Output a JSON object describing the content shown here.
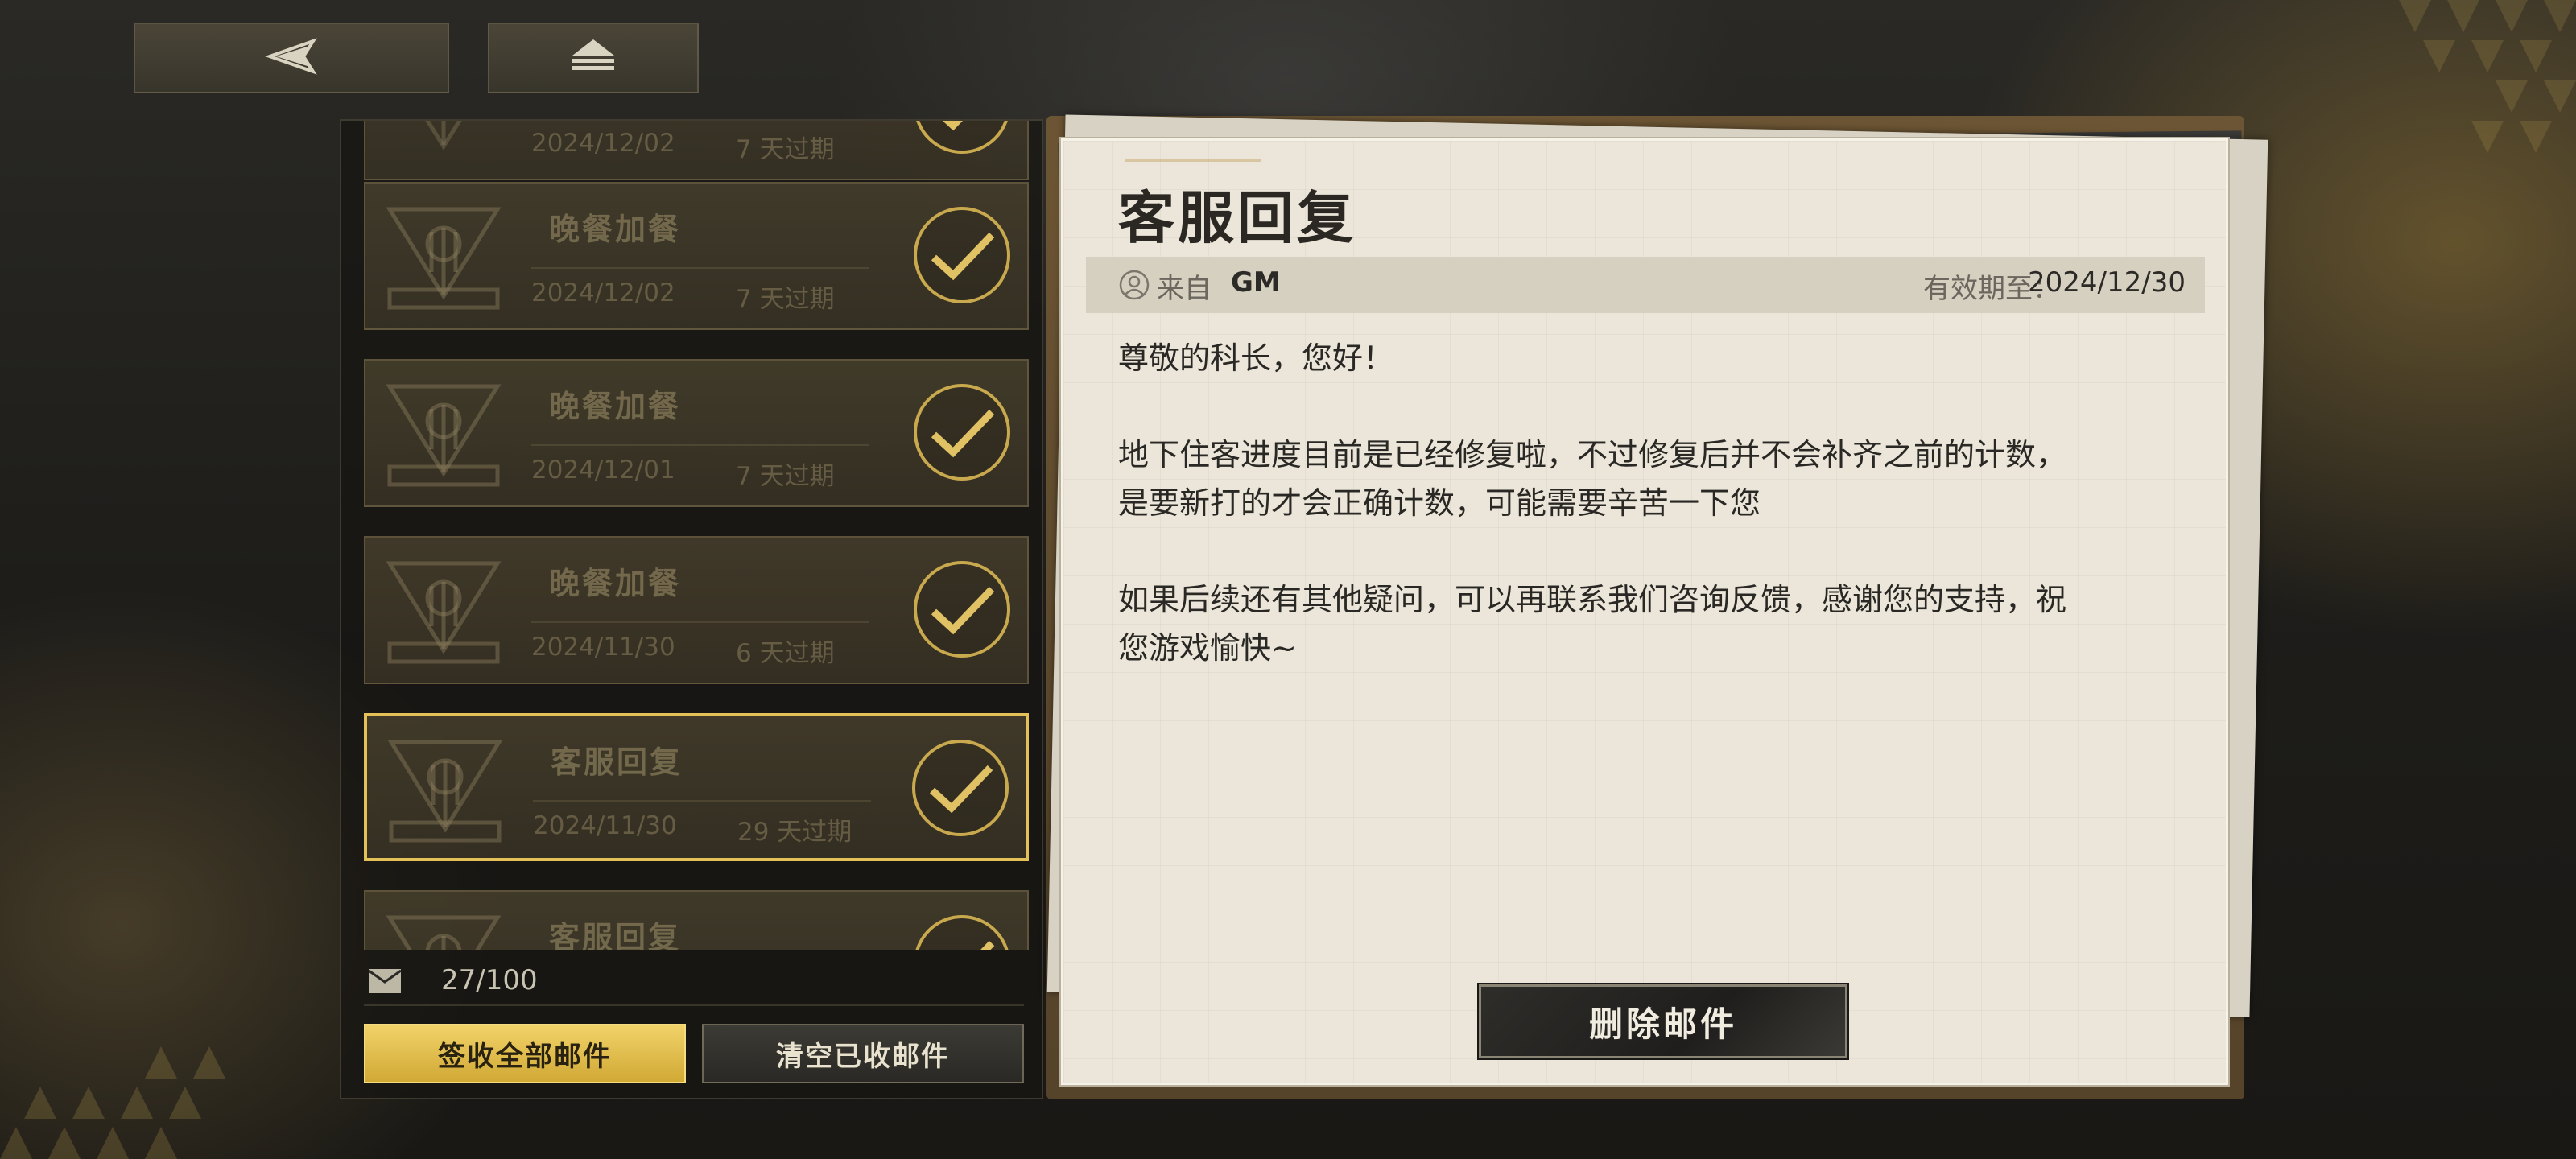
{
  "nav": {
    "back_icon": "back-arrow-icon",
    "home_icon": "home-icon"
  },
  "mail_list": {
    "items": [
      {
        "title": "",
        "date": "2024/12/02",
        "expiry": "7 天过期",
        "claimed": true,
        "selected": false
      },
      {
        "title": "晚餐加餐",
        "date": "2024/12/02",
        "expiry": "7 天过期",
        "claimed": true,
        "selected": false
      },
      {
        "title": "晚餐加餐",
        "date": "2024/12/01",
        "expiry": "7 天过期",
        "claimed": true,
        "selected": false
      },
      {
        "title": "晚餐加餐",
        "date": "2024/11/30",
        "expiry": "6 天过期",
        "claimed": true,
        "selected": false
      },
      {
        "title": "客服回复",
        "date": "2024/11/30",
        "expiry": "29 天过期",
        "claimed": true,
        "selected": true
      },
      {
        "title": "客服回复",
        "date": "",
        "expiry": "",
        "claimed": true,
        "selected": false
      }
    ],
    "count": "27/100",
    "claim_all_label": "签收全部邮件",
    "clear_label": "清空已收邮件"
  },
  "detail": {
    "title": "客服回复",
    "from_label": "来自",
    "from_name": "GM",
    "valid_label": "有效期至：",
    "valid_date": "2024/12/30",
    "body": [
      "尊敬的科长，您好！",
      "地下住客进度目前是已经修复啦，不过修复后并不会补齐之前的计数，\n是要新打的才会正确计数，可能需要辛苦一下您",
      "如果后续还有其他疑问，可以再联系我们咨询反馈，感谢您的支持，祝\n您游戏愉快~"
    ],
    "delete_label": "删除邮件"
  },
  "colors": {
    "accent_gold": "#e3c158",
    "paper": "#ebe6d9",
    "frame": "#6c5534"
  }
}
